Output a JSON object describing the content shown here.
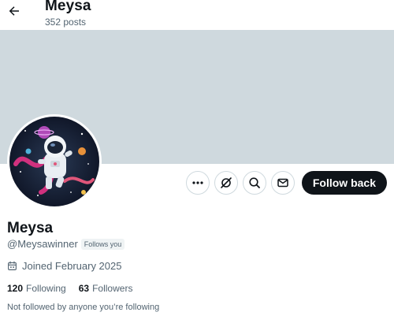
{
  "header": {
    "title": "Meysa",
    "posts_count": "352 posts"
  },
  "actions": {
    "more_icon": "more-horizontal-icon",
    "grok_icon": "grok-icon",
    "search_icon": "search-icon",
    "message_icon": "envelope-icon",
    "follow_label": "Follow back"
  },
  "profile": {
    "name": "Meysa",
    "handle": "@Meysawinner",
    "follows_you": "Follows you",
    "joined": "Joined February 2025",
    "following_count": "120",
    "following_label": "Following",
    "followers_count": "63",
    "followers_label": "Followers",
    "not_followed_text": "Not followed by anyone you’re following"
  },
  "colors": {
    "banner": "#cfd9de",
    "follow_button": "#0f1419",
    "secondary_text": "#536471"
  }
}
